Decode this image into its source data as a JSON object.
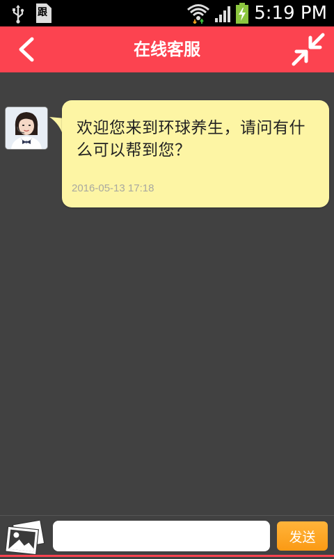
{
  "status_bar": {
    "time": "5:19 PM",
    "icons": [
      "usb-icon",
      "sim-icon",
      "wifi-icon",
      "signal-icon",
      "battery-charging-icon"
    ],
    "sim_label": "跟"
  },
  "header": {
    "title": "在线客服",
    "back_icon": "chevron-left-icon",
    "minimize_icon": "collapse-arrows-icon",
    "background_color": "#fc4350"
  },
  "chat": {
    "messages": [
      {
        "sender": "agent",
        "avatar_icon": "agent-avatar",
        "text": "欢迎您来到环球养生，请问有什么可以帮到您？",
        "timestamp": "2016-05-13 17:18",
        "bubble_color": "#fdf5a4"
      }
    ]
  },
  "input_bar": {
    "image_icon": "image-icon",
    "input_value": "",
    "input_placeholder": "",
    "send_label": "发送",
    "send_color": "#fb9a14"
  }
}
